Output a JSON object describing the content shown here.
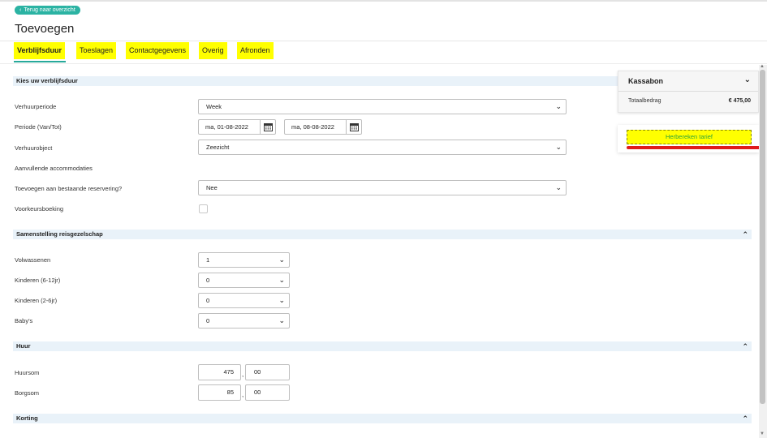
{
  "header": {
    "back_label": "Terug naar overzicht",
    "title": "Toevoegen"
  },
  "tabs": [
    {
      "label": "Verblijfsduur",
      "active": true
    },
    {
      "label": "Toeslagen",
      "active": false
    },
    {
      "label": "Contactgegevens",
      "active": false
    },
    {
      "label": "Overig",
      "active": false
    },
    {
      "label": "Afronden",
      "active": false
    }
  ],
  "sections": {
    "verblijfsduur": {
      "title": "Kies uw verblijfsduur",
      "verhuurperiode_label": "Verhuurperiode",
      "verhuurperiode_value": "Week",
      "periode_label": "Periode (Van/Tot)",
      "periode_van": "ma, 01-08-2022",
      "periode_tot": "ma, 08-08-2022",
      "verhuurobject_label": "Verhuurobject",
      "verhuurobject_value": "Zeezicht",
      "aanvullende_label": "Aanvullende accommodaties",
      "toevoegen_label": "Toevoegen aan bestaande reservering?",
      "toevoegen_value": "Nee",
      "voorkeur_label": "Voorkeursboeking",
      "voorkeur_checked": false
    },
    "reisgezelschap": {
      "title": "Samenstelling reisgezelschap",
      "volwassenen_label": "Volwassenen",
      "volwassenen_value": "1",
      "kinderen_612_label": "Kinderen (6-12jr)",
      "kinderen_612_value": "0",
      "kinderen_26_label": "Kinderen (2-6jr)",
      "kinderen_26_value": "0",
      "babys_label": "Baby's",
      "babys_value": "0"
    },
    "huur": {
      "title": "Huur",
      "huursom_label": "Huursom",
      "huursom_int": "475",
      "huursom_dec": "00",
      "borgsom_label": "Borgsom",
      "borgsom_int": "85",
      "borgsom_dec": "00",
      "decimal_sep": ","
    },
    "korting": {
      "title": "Korting"
    }
  },
  "kassabon": {
    "title": "Kassabon",
    "total_label": "Totaalbedrag",
    "total_value": "€ 475,00",
    "recalc_label": "Herbereken tarief"
  },
  "colors": {
    "accent": "#2bb3a3",
    "highlight": "#ffff00",
    "section_bg": "#e9f2f9",
    "annotation_red": "#e01b1b"
  }
}
